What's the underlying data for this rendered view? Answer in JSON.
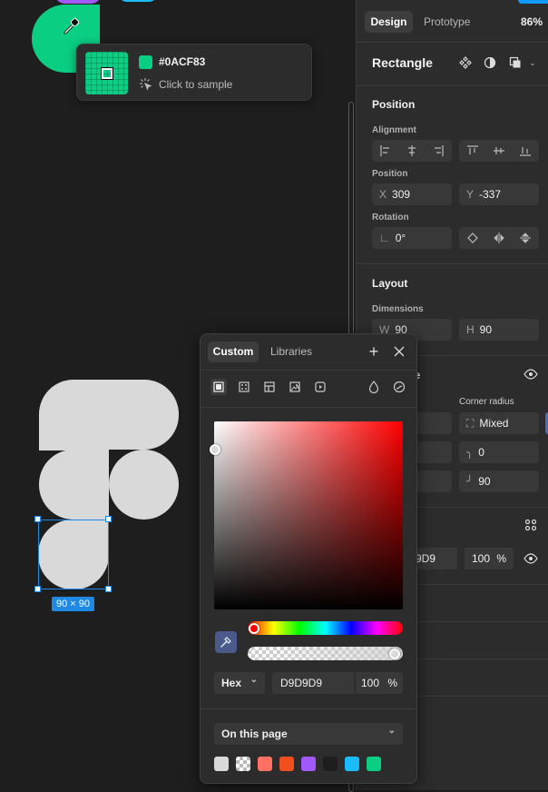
{
  "canvas": {
    "selection_size_label": "90 × 90",
    "shape_color": "#d9d9d9",
    "selection_color": "#1e88e5",
    "green_shape_color": "#0acf83"
  },
  "eyedropper_tooltip": {
    "hex": "#0ACF83",
    "hint": "Click to sample",
    "color": "#0acf83"
  },
  "panel": {
    "tabs": [
      {
        "label": "Design",
        "active": true
      },
      {
        "label": "Prototype",
        "active": false
      }
    ],
    "zoom": "86%",
    "layer_name": "Rectangle",
    "position": {
      "title": "Position",
      "alignment_label": "Alignment",
      "position_label": "Position",
      "x_prefix": "X",
      "x_value": "309",
      "y_prefix": "Y",
      "y_value": "-337",
      "rotation_label": "Rotation",
      "rotation_value": "0°"
    },
    "layout": {
      "title": "Layout",
      "dimensions_label": "Dimensions",
      "w_prefix": "W",
      "w_value": "90",
      "h_prefix": "H",
      "h_value": "90"
    },
    "appearance": {
      "title_partial": "ce",
      "corner_radius_label": "Corner radius",
      "field1_partial": "s",
      "corner_mixed": "Mixed",
      "corner_tr": "0",
      "corner_br": "90"
    },
    "fill": {
      "hex_partial": "9D9",
      "opacity": "100",
      "opacity_unit": "%"
    }
  },
  "picker": {
    "tabs": [
      {
        "label": "Custom",
        "active": true
      },
      {
        "label": "Libraries",
        "active": false
      }
    ],
    "format": "Hex",
    "hex_value": "D9D9D9",
    "opacity": "100",
    "opacity_unit": "%",
    "palette_source": "On this page",
    "swatches": [
      "#d9d9d9",
      "checker",
      "#ff7262",
      "#f24e1e",
      "#a259ff",
      "#1e1e1e",
      "#1abcfe",
      "#0acf83"
    ]
  }
}
